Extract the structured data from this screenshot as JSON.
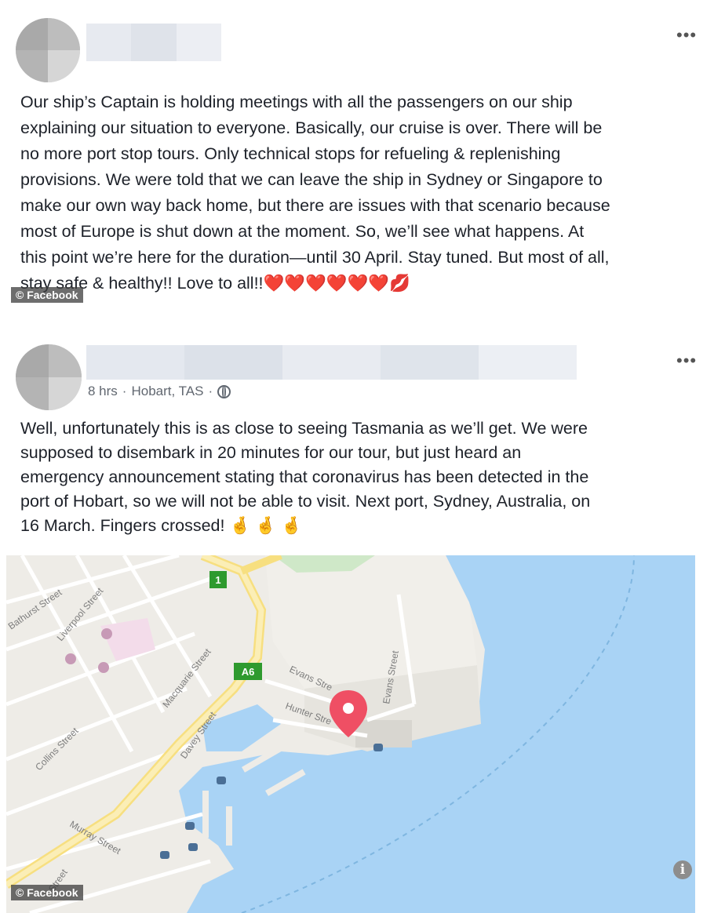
{
  "post1": {
    "text_lines": [
      "Our ship’s Captain is holding meetings with all the passengers on our ship",
      "explaining our situation to everyone. Basically, our cruise is over. There will be",
      "no more port stop tours. Only technical stops for refueling & replenishing",
      "provisions. We were told that we can leave the ship in Sydney or Singapore to",
      "make our own way back home, but there are issues with that scenario because",
      "most of Europe is shut down at the moment. So, we’ll see what happens. At",
      "this point we’re here for the duration—until 30 April. Stay tuned. But most of all,",
      "stay safe & healthy!! Love to all!!❤️❤️❤️❤️❤️❤️💋"
    ],
    "more_label": "•••",
    "watermark": "© Facebook"
  },
  "post2": {
    "meta_time": "8 hrs",
    "meta_sep": "·",
    "meta_location": "Hobart, TAS",
    "meta_sep2": "·",
    "more_label": "•••",
    "text_lines": [
      "Well, unfortunately this is as close to seeing Tasmania as we’ll get. We were",
      "supposed to disembark in 20 minutes for our tour, but just heard an",
      "emergency announcement stating that coronavirus has been detected in the",
      "port of Hobart, so we will not be able to visit. Next port, Sydney, Australia, on",
      "16 March. Fingers crossed! 🤞 🤞 🤞"
    ],
    "watermark": "© Facebook"
  },
  "map": {
    "street_labels": {
      "bathurst": "Bathurst Street",
      "liverpool": "Liverpool Street",
      "macquarie": "Macquarie Street",
      "davey": "Davey Street",
      "collins": "Collins Street",
      "murray": "Murray Street",
      "evans1": "Evans Stre",
      "evans2": "Evans Street",
      "hunter": "Hunter Stre",
      "street_edge": "Street"
    },
    "route_shields": {
      "r1": "1",
      "a6": "A6"
    },
    "info_glyph": "i",
    "colors": {
      "water": "#a9d3f5",
      "land": "#eeece7",
      "road_major": "#fbe9a4",
      "pin": "#ef4f64",
      "shield": "#2e9a2e"
    }
  }
}
